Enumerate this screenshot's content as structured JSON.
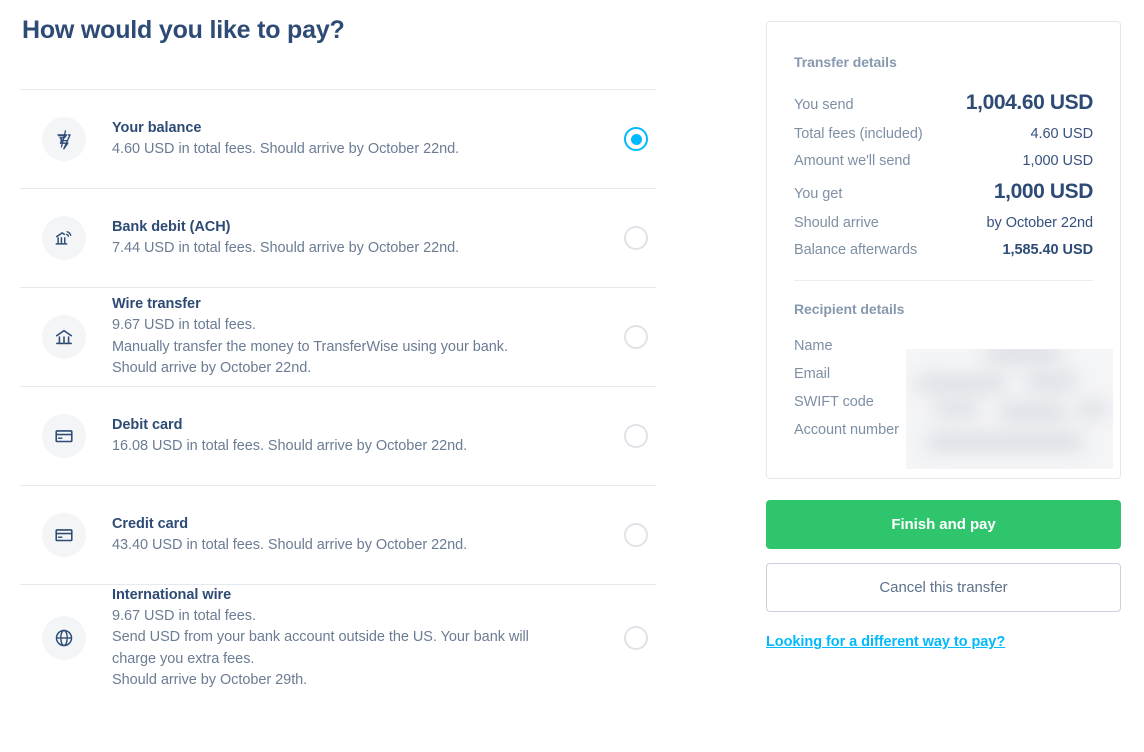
{
  "page": {
    "title": "How would you like to pay?"
  },
  "payment_methods": [
    {
      "id": "your-balance",
      "icon": "transferwise-logo-icon",
      "title": "Your balance",
      "lines": [
        "4.60 USD in total fees. Should arrive by October 22nd."
      ],
      "selected": true
    },
    {
      "id": "bank-debit-ach",
      "icon": "bank-signal-icon",
      "title": "Bank debit (ACH)",
      "lines": [
        "7.44 USD in total fees. Should arrive by October 22nd."
      ],
      "selected": false
    },
    {
      "id": "wire-transfer",
      "icon": "bank-icon",
      "title": "Wire transfer",
      "lines": [
        "9.67 USD in total fees.",
        "Manually transfer the money to TransferWise using your bank.",
        "Should arrive by October 22nd."
      ],
      "selected": false
    },
    {
      "id": "debit-card",
      "icon": "card-icon",
      "title": "Debit card",
      "lines": [
        "16.08 USD in total fees. Should arrive by October 22nd."
      ],
      "selected": false
    },
    {
      "id": "credit-card",
      "icon": "card-icon",
      "title": "Credit card",
      "lines": [
        "43.40 USD in total fees. Should arrive by October 22nd."
      ],
      "selected": false
    },
    {
      "id": "international-wire",
      "icon": "globe-icon",
      "title": "International wire",
      "lines": [
        "9.67 USD in total fees.",
        "Send USD from your bank account outside the US. Your bank will",
        "charge you extra fees.",
        "Should arrive by October 29th."
      ],
      "selected": false
    }
  ],
  "summary": {
    "transfer_details_title": "Transfer details",
    "rows": [
      {
        "label": "You send",
        "value": "1,004.60 USD",
        "style": "big"
      },
      {
        "label": "Total fees (included)",
        "value": "4.60 USD",
        "style": "normal"
      },
      {
        "label": "Amount we'll send",
        "value": "1,000 USD",
        "style": "normal"
      },
      {
        "label": "You get",
        "value": "1,000 USD",
        "style": "big"
      },
      {
        "label": "Should arrive",
        "value": "by October 22nd",
        "style": "normal"
      },
      {
        "label": "Balance afterwards",
        "value": "1,585.40 USD",
        "style": "bold"
      }
    ],
    "recipient_details_title": "Recipient details",
    "recipient_rows": [
      {
        "label": "Name",
        "value": ""
      },
      {
        "label": "Email",
        "value": ""
      },
      {
        "label": "SWIFT code",
        "value": ""
      },
      {
        "label": "Account number",
        "value": ""
      }
    ]
  },
  "actions": {
    "primary_label": "Finish and pay",
    "secondary_label": "Cancel this transfer",
    "alt_link_label": "Looking for a different way to pay?"
  },
  "colors": {
    "accent_blue": "#00b9ff",
    "heading_navy": "#2d4b75",
    "muted_text": "#6b7c93",
    "primary_green": "#2fc56d",
    "divider": "#e7eaec"
  }
}
